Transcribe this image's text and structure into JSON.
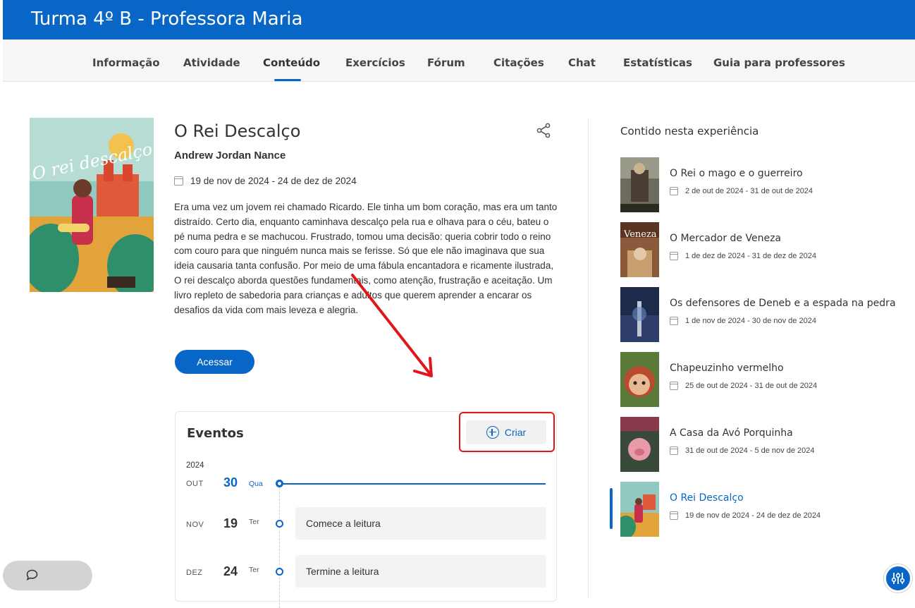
{
  "header": {
    "title": "Turma 4º B - Professora Maria"
  },
  "nav": {
    "tabs": [
      {
        "label": "Informação"
      },
      {
        "label": "Atividade"
      },
      {
        "label": "Conteúdo"
      },
      {
        "label": "Exercícios"
      },
      {
        "label": "Fórum"
      },
      {
        "label": "Citações"
      },
      {
        "label": "Chat"
      },
      {
        "label": "Estatísticas"
      },
      {
        "label": "Guia para professores"
      }
    ],
    "active": "Conteúdo"
  },
  "book": {
    "title": "O Rei Descalço",
    "author": "Andrew Jordan Nance",
    "dates": "19 de nov de 2024 - 24 de dez de 2024",
    "description": "Era uma vez um jovem rei chamado Ricardo. Ele tinha um bom coração, mas era um tanto distraído. Certo dia, enquanto caminhava descalço pela rua e olhava para o céu, bateu o pé numa pedra e se machucou. Frustrado, tomou uma decisão: queria cobrir todo o reino com couro para que ninguém nunca mais se ferisse. Só que ele não imaginava que sua ideia causaria tanta confusão. Por meio de uma fábula encantadora e ricamente ilustrada, O rei descalço aborda questões fundamentais, como atenção, frustração e aceitação. Um livro repleto de sabedoria para crianças e adultos que querem aprender a encarar os desafios da vida com mais leveza e alegria.",
    "access_label": "Acessar",
    "cover_text": "O rei descalço"
  },
  "events": {
    "title": "Eventos",
    "create_label": "Criar",
    "year": "2024",
    "rows": [
      {
        "month": "OUT",
        "day": "30",
        "weekday": "Qua",
        "label": ""
      },
      {
        "month": "NOV",
        "day": "19",
        "weekday": "Ter",
        "label": "Comece a leitura"
      },
      {
        "month": "DEZ",
        "day": "24",
        "weekday": "Ter",
        "label": "Termine a leitura"
      }
    ]
  },
  "sidebar": {
    "title": "Contido nesta experiência",
    "items": [
      {
        "name": "O Rei o mago e o guerreiro",
        "dates": "2 de out de 2024 - 31 de out de 2024",
        "active": false
      },
      {
        "name": "O Mercador de Veneza",
        "dates": "1 de dez de 2024 - 31 de dez de 2024",
        "active": false,
        "cover_text": "Veneza"
      },
      {
        "name": "Os defensores de Deneb e a espada na pedra",
        "dates": "1 de nov de 2024 - 30 de nov de 2024",
        "active": false
      },
      {
        "name": "Chapeuzinho vermelho",
        "dates": "25 de out de 2024 - 31 de out de 2024",
        "active": false
      },
      {
        "name": "A Casa da Avó Porquinha",
        "dates": "31 de out de 2024 - 5 de nov de 2024",
        "active": false
      },
      {
        "name": "O Rei Descalço",
        "dates": "19 de nov de 2024 - 24 de dez de 2024",
        "active": true
      }
    ]
  },
  "colors": {
    "primary": "#0866c6",
    "highlight": "#e0161b"
  }
}
